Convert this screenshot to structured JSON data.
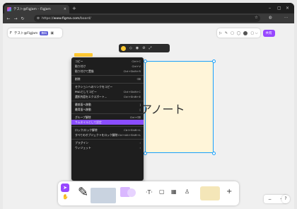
{
  "browser": {
    "tab_title": "テスト@FigJam – FigJam",
    "tab_close": "×",
    "new_tab": "+",
    "url_scheme": "https://",
    "url_host": "www.figma.com",
    "url_path": "/board/"
  },
  "file": {
    "name": "テスト@FigJam",
    "badge": "無料",
    "share_label": "共有",
    "zoom_menu": "▢ ⌵"
  },
  "context_menu": {
    "items": [
      {
        "label": "コピー",
        "shortcut": "Ctrl+C"
      },
      {
        "label": "貼り付け",
        "shortcut": "Ctrl+V"
      },
      {
        "label": "貼り付けて置換",
        "shortcut": "Ctrl+Shift+R"
      },
      {
        "label": "削除",
        "shortcut": "⌫"
      },
      {
        "label": "セクションへのリンクをコピー",
        "shortcut": ""
      },
      {
        "label": "PNGとしてコピー",
        "shortcut": "Ctrl+Shift+C"
      },
      {
        "label": "選択内容をエクスポート…",
        "shortcut": "Ctrl+Shift+E"
      },
      {
        "label": "最前面へ移動",
        "shortcut": "]"
      },
      {
        "label": "最背面へ移動",
        "shortcut": "["
      },
      {
        "label": "グループ解除",
        "shortcut": "Ctrl+⌫"
      },
      {
        "label": "サムネイルとして設定",
        "shortcut": ""
      },
      {
        "label": "ロック/ロック解除",
        "shortcut": "Ctrl+Shift+L"
      },
      {
        "label": "すべてのオブジェクトをロック解除",
        "shortcut": "Ctrl+Alt+Shift+L"
      },
      {
        "label": "プラグイン",
        "shortcut": "›"
      },
      {
        "label": "ウィジェット",
        "shortcut": "›"
      }
    ],
    "highlighted_index": 10
  },
  "canvas": {
    "sticky_text": "アノート",
    "sticky_color": "#fff5d9",
    "selection_color": "#18a0fb"
  },
  "toolbar": {
    "text_tool": "T",
    "add_label": "+"
  },
  "zoom": {
    "minus": "−",
    "plus": "+",
    "help": "?"
  }
}
